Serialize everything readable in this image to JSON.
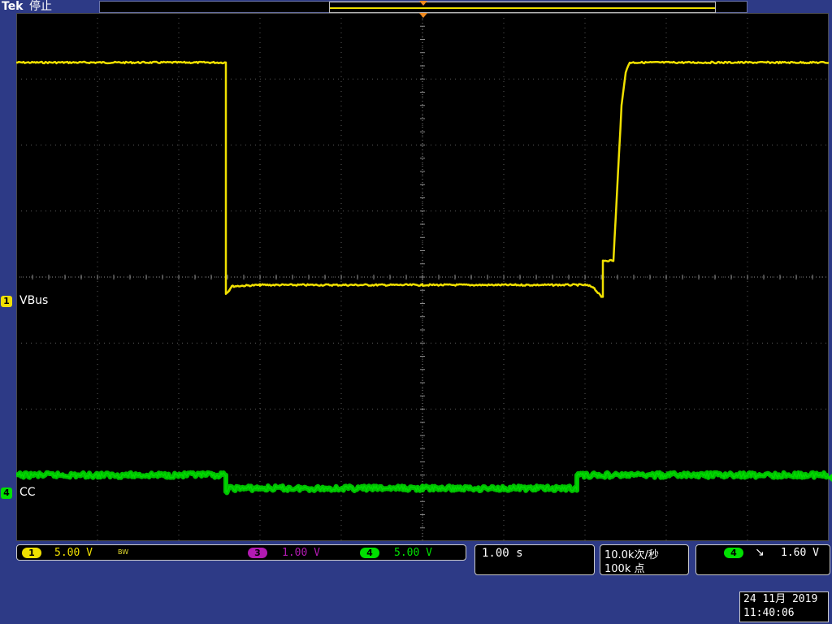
{
  "header": {
    "brand": "Tek",
    "status": "停止"
  },
  "channels": [
    {
      "id": "1",
      "label": "VBus",
      "color": "#f0e000"
    },
    {
      "id": "4",
      "label": "CC",
      "color": "#00e000"
    }
  ],
  "scales": {
    "ch1": {
      "num": "1",
      "value": "5.00 V",
      "bw": "BW",
      "color": "#f0e000"
    },
    "ch3": {
      "num": "3",
      "value": "1.00 V",
      "color": "#b21ab2"
    },
    "ch4": {
      "num": "4",
      "value": "5.00 V",
      "color": "#00e000"
    }
  },
  "timebase": {
    "value": "1.00 s"
  },
  "acquisition": {
    "rate": "10.0k次/秒",
    "points": "100k 点"
  },
  "trigger": {
    "channel": "4",
    "slope_symbol": "↘",
    "level": "1.60 V",
    "color": "#00e000"
  },
  "datetime": {
    "date": "24 11月 2019",
    "time": "11:40:06"
  },
  "chart_data": {
    "type": "line",
    "grid": true,
    "divisions": {
      "x": 10,
      "y": 8
    },
    "x_unit_per_div": "1.00 s",
    "series": [
      {
        "name": "VBus",
        "color": "#f0e000",
        "points_div": [
          [
            0,
            3.25
          ],
          [
            2.58,
            3.25
          ],
          [
            2.58,
            -0.25
          ],
          [
            2.62,
            -0.2
          ],
          [
            2.62,
            -0.2
          ],
          [
            2.65,
            -0.14
          ],
          [
            3.0,
            -0.12
          ],
          [
            5.0,
            -0.12
          ],
          [
            7.0,
            -0.12
          ],
          [
            7.1,
            -0.15
          ],
          [
            7.2,
            -0.3
          ],
          [
            7.22,
            -0.3
          ],
          [
            7.22,
            0.25
          ],
          [
            7.35,
            0.25
          ],
          [
            7.45,
            2.6
          ],
          [
            7.5,
            3.1
          ],
          [
            7.55,
            3.25
          ],
          [
            10,
            3.25
          ]
        ]
      },
      {
        "name": "CC",
        "color": "#00e000",
        "points_div": [
          [
            0,
            -3.0
          ],
          [
            2.58,
            -3.0
          ],
          [
            2.58,
            -3.25
          ],
          [
            2.62,
            -3.2
          ],
          [
            5.0,
            -3.2
          ],
          [
            6.9,
            -3.2
          ],
          [
            6.9,
            -3.0
          ],
          [
            10,
            -3.0
          ]
        ]
      }
    ]
  }
}
